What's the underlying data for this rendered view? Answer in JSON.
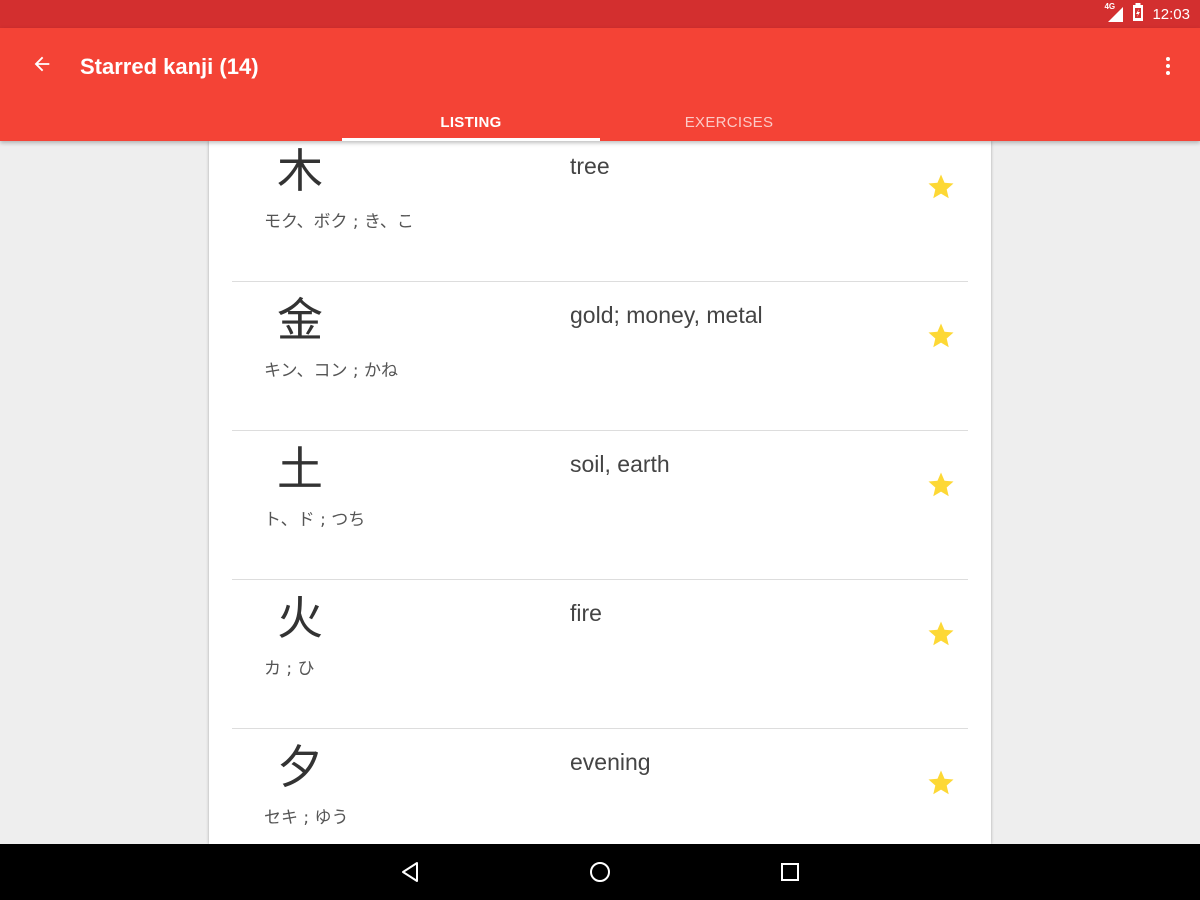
{
  "status_bar": {
    "time": "12:03",
    "network": "4G",
    "signal_icon": "signal-icon",
    "battery_icon": "battery-icon"
  },
  "app_bar": {
    "title": "Starred kanji (14)",
    "back_icon": "arrow-back-icon",
    "menu_icon": "more-vert-icon",
    "background": "#f44336",
    "status_color": "#d32f2f"
  },
  "tabs": [
    {
      "label": "LISTING",
      "selected": true
    },
    {
      "label": "EXERCISES",
      "selected": false
    }
  ],
  "kanji_list": [
    {
      "kanji": "木",
      "reading": "モク、ボク ; き、こ",
      "meaning": "tree",
      "starred": true
    },
    {
      "kanji": "金",
      "reading": "キン、コン ; かね",
      "meaning": "gold; money, metal",
      "starred": true
    },
    {
      "kanji": "土",
      "reading": "ト、ド ; つち",
      "meaning": "soil, earth",
      "starred": true
    },
    {
      "kanji": "火",
      "reading": "カ ; ひ",
      "meaning": "fire",
      "starred": true
    },
    {
      "kanji": "夕",
      "reading": "セキ ; ゆう",
      "meaning": "evening",
      "starred": true
    }
  ],
  "star_color": "#fdd835",
  "nav_bar": {
    "back_icon": "nav-back-icon",
    "home_icon": "nav-home-icon",
    "recents_icon": "nav-recents-icon"
  }
}
